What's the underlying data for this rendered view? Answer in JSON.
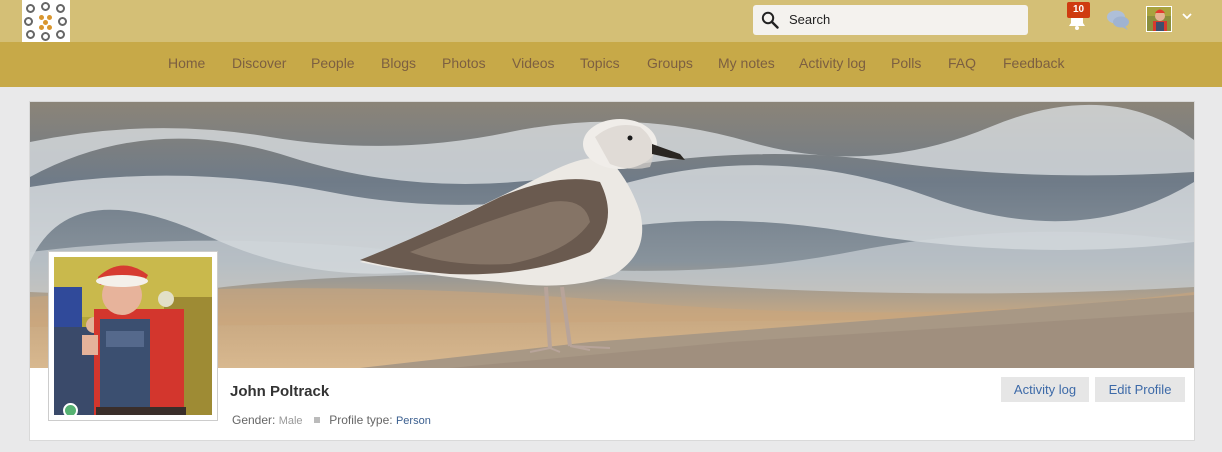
{
  "header": {
    "search_placeholder": "Search",
    "notification_count": "10"
  },
  "nav": {
    "items": [
      "Home",
      "Discover",
      "People",
      "Blogs",
      "Photos",
      "Videos",
      "Topics",
      "Groups",
      "My notes",
      "Activity log",
      "Polls",
      "FAQ",
      "Feedback"
    ]
  },
  "profile": {
    "name": "John Poltrack",
    "gender_label": "Gender:",
    "gender_value": "Male",
    "type_label": "Profile type:",
    "type_value": "Person",
    "status": "online"
  },
  "actions": {
    "activity_log": "Activity log",
    "edit_profile": "Edit Profile"
  },
  "colors": {
    "topbar": "#d4bf76",
    "navbar": "#c7a948",
    "nav_text": "#7c5f41",
    "badge": "#cf3b10",
    "online": "#56b272",
    "button_text": "#3d6aa8"
  }
}
